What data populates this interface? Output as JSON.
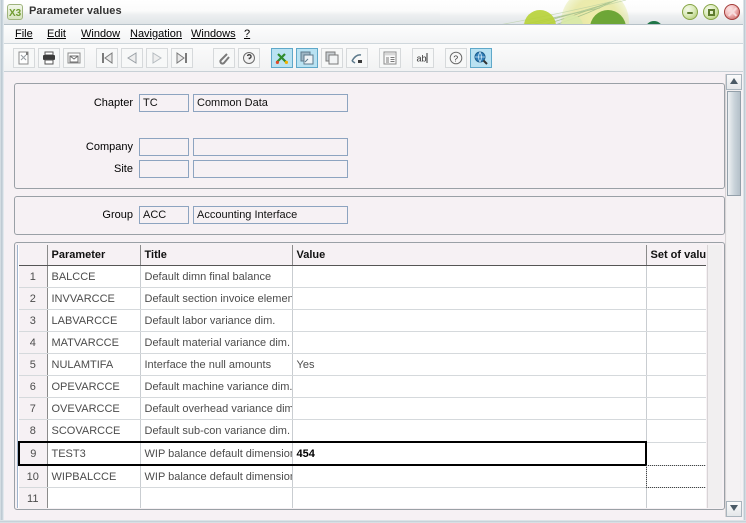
{
  "window": {
    "title": "Parameter values",
    "app_icon": "x3-logo-icon",
    "controls": {
      "minimize": "minimize-button",
      "maximize": "maximize-button",
      "close": "close-button"
    }
  },
  "menu": {
    "items": [
      {
        "label": "File",
        "mnemonic": "F"
      },
      {
        "label": "Edit",
        "mnemonic": "E"
      },
      {
        "label": "Window",
        "mnemonic": "W"
      },
      {
        "label": "Navigation",
        "mnemonic": "N"
      },
      {
        "label": "Windows",
        "mnemonic": "W"
      },
      {
        "label": "?",
        "mnemonic": "?"
      }
    ]
  },
  "toolbar": {
    "buttons": [
      {
        "name": "new-icon",
        "selected": false
      },
      {
        "name": "print-icon",
        "selected": false
      },
      {
        "name": "mail-icon",
        "selected": false
      },
      {
        "name": "first-record-icon",
        "selected": false
      },
      {
        "name": "previous-record-icon",
        "selected": false
      },
      {
        "name": "next-record-icon",
        "selected": false
      },
      {
        "name": "last-record-icon",
        "selected": false
      },
      {
        "name": "attachment-icon",
        "selected": false
      },
      {
        "name": "info-icon",
        "selected": false
      },
      {
        "name": "tools-icon",
        "selected": true
      },
      {
        "name": "copy-icon",
        "selected": true
      },
      {
        "name": "duplicate-icon",
        "selected": false
      },
      {
        "name": "export-icon",
        "selected": false
      },
      {
        "name": "report-icon",
        "selected": false
      },
      {
        "name": "text-icon",
        "selected": false
      },
      {
        "name": "help-icon",
        "selected": false
      },
      {
        "name": "search-globe-icon",
        "selected": true
      }
    ]
  },
  "form": {
    "chapter": {
      "label": "Chapter",
      "code_value": "TC",
      "desc_value": "Common Data"
    },
    "company": {
      "label": "Company",
      "code_value": "",
      "desc_value": ""
    },
    "site": {
      "label": "Site",
      "code_value": "",
      "desc_value": ""
    },
    "group": {
      "label": "Group",
      "code_value": "ACC",
      "desc_value": "Accounting Interface"
    }
  },
  "grid": {
    "columns": [
      "Parameter",
      "Title",
      "Value",
      "Set of values"
    ],
    "rows": [
      {
        "n": "1",
        "parameter": "BALCCE",
        "title": "Default dimn final balance",
        "value": "",
        "set_of_values": "",
        "selected": false,
        "focus_cell": ""
      },
      {
        "n": "2",
        "parameter": "INVVARCCE",
        "title": "Default section invoice elemen",
        "value": "",
        "set_of_values": "",
        "selected": false,
        "focus_cell": ""
      },
      {
        "n": "3",
        "parameter": "LABVARCCE",
        "title": "Default labor variance dim.",
        "value": "",
        "set_of_values": "",
        "selected": false,
        "focus_cell": ""
      },
      {
        "n": "4",
        "parameter": "MATVARCCE",
        "title": "Default material variance dim.",
        "value": "",
        "set_of_values": "",
        "selected": false,
        "focus_cell": ""
      },
      {
        "n": "5",
        "parameter": "NULAMTIFA",
        "title": "Interface the null amounts",
        "value": "Yes",
        "set_of_values": "",
        "selected": false,
        "focus_cell": ""
      },
      {
        "n": "6",
        "parameter": "OPEVARCCE",
        "title": "Default machine variance dim.",
        "value": "",
        "set_of_values": "",
        "selected": false,
        "focus_cell": ""
      },
      {
        "n": "7",
        "parameter": "OVEVARCCE",
        "title": "Default overhead variance dim",
        "value": "",
        "set_of_values": "",
        "selected": false,
        "focus_cell": ""
      },
      {
        "n": "8",
        "parameter": "SCOVARCCE",
        "title": "Default sub-con variance dim.",
        "value": "",
        "set_of_values": "",
        "selected": false,
        "focus_cell": ""
      },
      {
        "n": "9",
        "parameter": "TEST3",
        "title": "WIP balance default dimension",
        "value": "454",
        "set_of_values": "",
        "selected": true,
        "focus_cell": ""
      },
      {
        "n": "10",
        "parameter": "WIPBALCCE",
        "title": "WIP balance default dimension",
        "value": "",
        "set_of_values": "",
        "selected": false,
        "focus_cell": "set_of_values"
      },
      {
        "n": "11",
        "parameter": "",
        "title": "",
        "value": "",
        "set_of_values": "",
        "selected": false,
        "focus_cell": ""
      }
    ]
  },
  "scrollbar": {
    "up_arrow": "scroll-up-icon",
    "down_arrow": "scroll-down-icon"
  },
  "colors": {
    "window_bg": "#f6f1f4",
    "accent_selected": "#b9e2f2",
    "field_border": "#8da4c0",
    "deco_green": "#7fae1b",
    "close_red": "#c0504d"
  }
}
